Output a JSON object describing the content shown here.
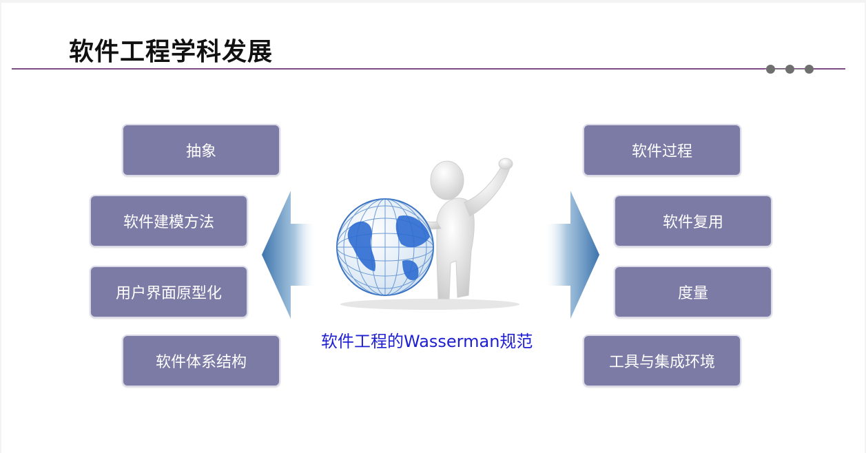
{
  "slide": {
    "title": "软件工程学科发展",
    "caption": "软件工程的Wasserman规范"
  },
  "left_boxes": [
    "抽象",
    "软件建模方法",
    "用户界面原型化",
    "软件体系结构"
  ],
  "right_boxes": [
    "软件过程",
    "软件复用",
    "度量",
    "工具与集成环境"
  ],
  "illustration": {
    "icon": "figure-leaning-on-globe-icon"
  },
  "colors": {
    "accent_rule": "#7e4c84",
    "box_fill": "#7b7ba6",
    "caption_text": "#1e1ed2",
    "arrow": "#4f86b8"
  }
}
